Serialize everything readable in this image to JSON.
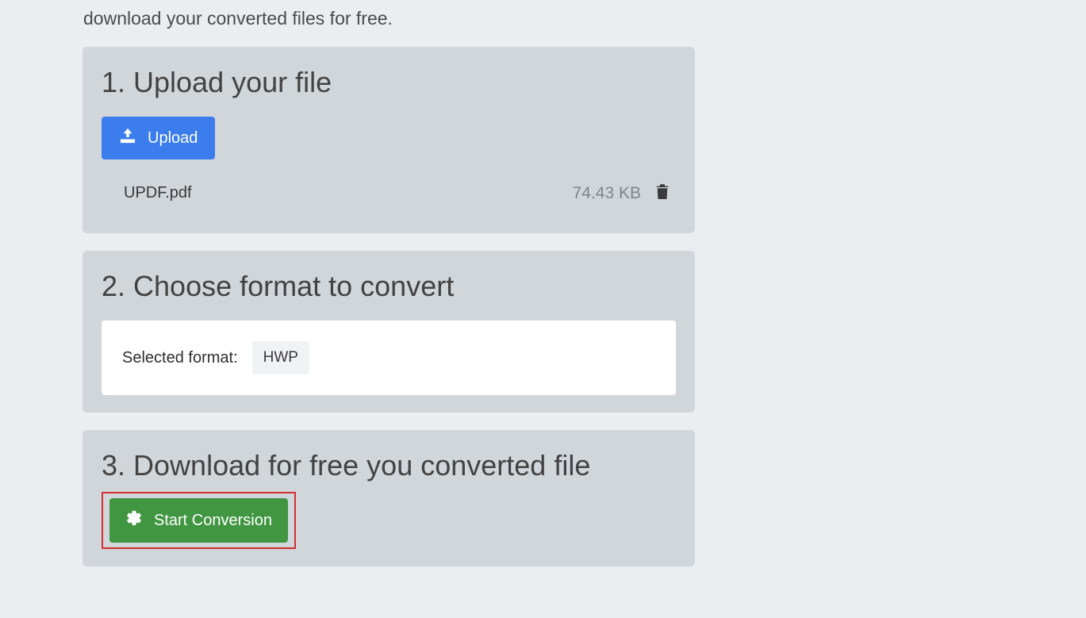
{
  "intro": {
    "text": "download your converted files for free."
  },
  "step1": {
    "heading": "1. Upload your file",
    "upload_label": "Upload",
    "file": {
      "name": "UPDF.pdf",
      "size": "74.43 KB"
    }
  },
  "step2": {
    "heading": "2. Choose format to convert",
    "selected_label": "Selected format:",
    "selected_value": "HWP"
  },
  "step3": {
    "heading": "3. Download for free you converted file",
    "convert_label": "Start Conversion"
  }
}
